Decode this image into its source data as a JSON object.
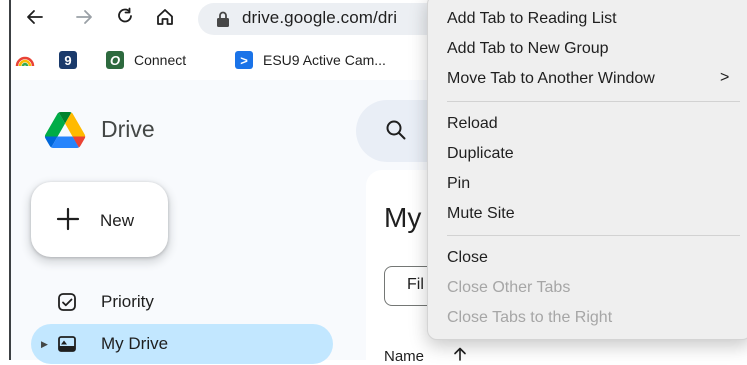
{
  "browser": {
    "url": "drive.google.com/dri",
    "nav_icons": [
      "back-arrow-icon",
      "forward-arrow-icon",
      "reload-icon",
      "home-icon"
    ]
  },
  "bookmarks": {
    "items": [
      {
        "label": "",
        "icon": "rainbow-icon"
      },
      {
        "label": "",
        "icon": "nine-icon",
        "glyph": "9"
      },
      {
        "label": "Connect",
        "icon": "connect-icon",
        "glyph": "O"
      },
      {
        "label": "ESU9 Active Cam...",
        "icon": "play-icon",
        "glyph": ">"
      }
    ]
  },
  "drive": {
    "title": "Drive",
    "new_label": "New",
    "nav": [
      {
        "label": "Priority",
        "icon": "priority-check-icon"
      },
      {
        "label": "My Drive",
        "icon": "my-drive-icon",
        "active": true
      }
    ],
    "page_title": "My",
    "filter_label": "Fil",
    "column_header": "Name"
  },
  "context_menu": {
    "items": [
      {
        "label": "Add Tab to Reading List",
        "enabled": true
      },
      {
        "label": "Add Tab to New Group",
        "enabled": true
      },
      {
        "label": "Move Tab to Another Window",
        "enabled": true,
        "submenu": ">"
      },
      {
        "label": "Reload",
        "enabled": true
      },
      {
        "label": "Duplicate",
        "enabled": true
      },
      {
        "label": "Pin",
        "enabled": true
      },
      {
        "label": "Mute Site",
        "enabled": true
      },
      {
        "label": "Close",
        "enabled": true
      },
      {
        "label": "Close Other Tabs",
        "enabled": false
      },
      {
        "label": "Close Tabs to the Right",
        "enabled": false
      }
    ]
  },
  "colors": {
    "nav_active": "#c2e7ff",
    "search_bg": "#e9eef6",
    "menu_bg": "#efefef",
    "disabled_text": "#a6a6a6"
  }
}
